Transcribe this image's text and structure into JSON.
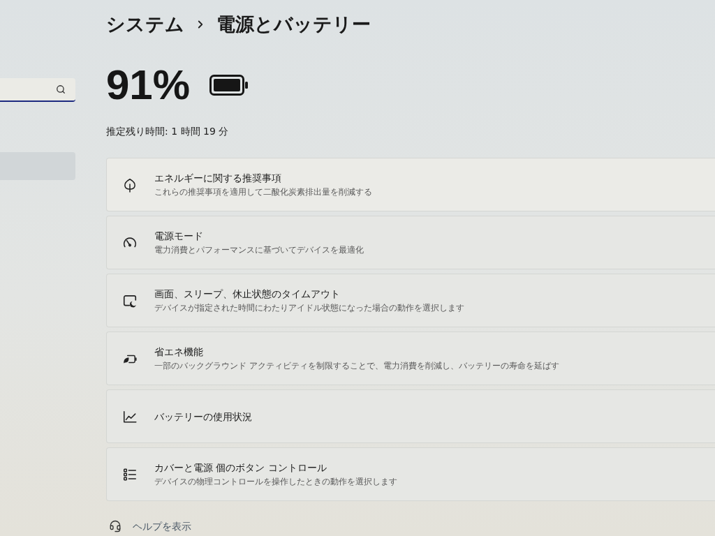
{
  "sidebar": {
    "search": {
      "focused": true
    },
    "items": [
      {
        "selected": true
      }
    ]
  },
  "breadcrumb": [
    "システム",
    "電源とバッテリー"
  ],
  "battery": {
    "percent": "91%",
    "remaining": "推定残り時間: 1 時間 19 分"
  },
  "settings": [
    {
      "title": "エネルギーに関する推奨事項",
      "description": "これらの推奨事項を適用して二酸化炭素排出量を削減する"
    },
    {
      "title": "電源モード",
      "description": "電力消費とパフォーマンスに基づいてデバイスを最適化"
    },
    {
      "title": "画面、スリープ、休止状態のタイムアウト",
      "description": "デバイスが指定された時間にわたりアイドル状態になった場合の動作を選択します"
    },
    {
      "title": "省エネ機能",
      "description": "一部のバックグラウンド アクティビティを制限することで、電力消費を削減し、バッテリーの寿命を延ばす"
    },
    {
      "title": "バッテリーの使用状況"
    },
    {
      "title": "カバーと電源 個のボタン コントロール",
      "description": "デバイスの物理コントロールを操作したときの動作を選択します"
    }
  ],
  "help_link": "ヘルプを表示"
}
